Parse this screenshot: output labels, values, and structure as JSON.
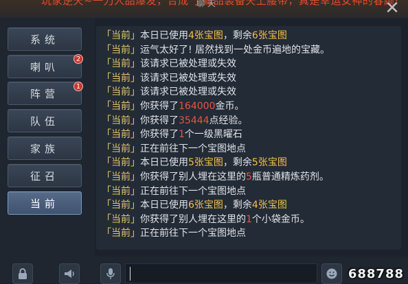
{
  "banner": {
    "text": "玩家逆天~一刀人品爆发，合成 了藏品装备天上腰带，真是幸运女神的春顾!",
    "mid": "聊 天"
  },
  "tabs": [
    {
      "label": "系统"
    },
    {
      "label": "喇叭",
      "badge": "2"
    },
    {
      "label": "阵营",
      "badge": "1"
    },
    {
      "label": "队伍"
    },
    {
      "label": "家族"
    },
    {
      "label": "征召"
    },
    {
      "label": "当前",
      "active": true
    }
  ],
  "chat": {
    "channel": "「当前」",
    "lines": [
      {
        "segs": [
          {
            "t": "本日已使用"
          },
          {
            "t": "4张宝图",
            "c": "hi"
          },
          {
            "t": "，剩余"
          },
          {
            "t": "6张宝图",
            "c": "hi"
          }
        ]
      },
      {
        "segs": [
          {
            "t": "运气太好了! 居然找到一处金币遍地的宝藏。"
          }
        ]
      },
      {
        "segs": [
          {
            "t": "该请求已被处理或失效"
          }
        ]
      },
      {
        "segs": [
          {
            "t": "该请求已被处理或失效"
          }
        ]
      },
      {
        "segs": [
          {
            "t": "该请求已被处理或失效"
          }
        ]
      },
      {
        "segs": [
          {
            "t": "你获得了"
          },
          {
            "t": "164000",
            "c": "red"
          },
          {
            "t": "金币。"
          }
        ]
      },
      {
        "segs": [
          {
            "t": "你获得了"
          },
          {
            "t": "35444",
            "c": "red"
          },
          {
            "t": "点经验。"
          }
        ]
      },
      {
        "segs": [
          {
            "t": "你获得了"
          },
          {
            "t": "1",
            "c": "red"
          },
          {
            "t": "个一级黑曜石"
          }
        ]
      },
      {
        "segs": [
          {
            "t": "正在前往下一个宝图地点"
          }
        ]
      },
      {
        "segs": [
          {
            "t": "本日已使用"
          },
          {
            "t": "5张宝图",
            "c": "hi"
          },
          {
            "t": "，剩余"
          },
          {
            "t": "5张宝图",
            "c": "hi"
          }
        ]
      },
      {
        "segs": [
          {
            "t": "你获得了别人埋在这里的"
          },
          {
            "t": "5",
            "c": "red"
          },
          {
            "t": "瓶普通精炼药剂。"
          }
        ]
      },
      {
        "segs": [
          {
            "t": "正在前往下一个宝图地点"
          }
        ]
      },
      {
        "segs": [
          {
            "t": "本日已使用"
          },
          {
            "t": "6张宝图",
            "c": "hi"
          },
          {
            "t": "，剩余"
          },
          {
            "t": "4张宝图",
            "c": "hi"
          }
        ]
      },
      {
        "segs": [
          {
            "t": "你获得了别人埋在这里的"
          },
          {
            "t": "1",
            "c": "red"
          },
          {
            "t": "个小袋金币。"
          }
        ]
      },
      {
        "segs": [
          {
            "t": "正在前往下一个宝图地点"
          }
        ]
      }
    ]
  },
  "icons": {
    "lock": "lock-icon",
    "speaker": "speaker-icon",
    "mic": "microphone-icon",
    "emoji": "emoji-icon"
  },
  "watermark": "688788"
}
